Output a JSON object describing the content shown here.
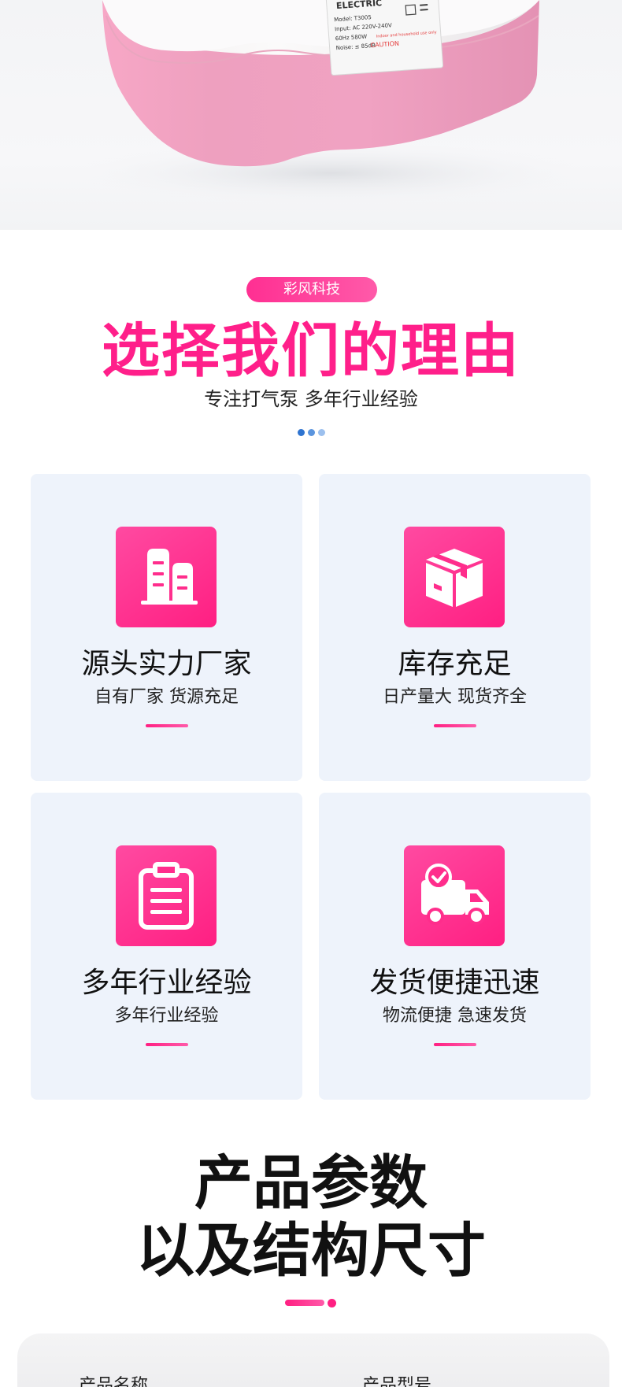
{
  "hero": {
    "device_label": {
      "brand": "ELECTRIC",
      "model": "Model: T3005",
      "input": "Input: AC 220V-240V",
      "freq": "60Hz 580W",
      "noise": "Noise: ≤ 85dB",
      "caution": "CAUTION",
      "indoor_note": "Indoor and household use only"
    }
  },
  "section_reasons": {
    "badge": "彩风科技",
    "title": "选择我们的理由",
    "subtitle": "专注打气泵 多年行业经验"
  },
  "cards": [
    {
      "title": "源头实力厂家",
      "subtitle": "自有厂家 货源充足",
      "icon": "building-icon"
    },
    {
      "title": "库存充足",
      "subtitle": "日产量大 现货齐全",
      "icon": "box-icon"
    },
    {
      "title": "多年行业经验",
      "subtitle": "多年行业经验",
      "icon": "clipboard-icon"
    },
    {
      "title": "发货便捷迅速",
      "subtitle": "物流便捷 急速发货",
      "icon": "truck-icon"
    }
  ],
  "section_params": {
    "title_line1": "产品参数",
    "title_line2": "以及结构尺寸",
    "label_name": "产品名称",
    "label_model": "产品型号"
  },
  "colors": {
    "accent": "#ff1f8a",
    "card_bg": "#eef3fb",
    "dot_1": "#2f74d0",
    "dot_2": "#5b95de",
    "dot_3": "#9cc0ee"
  }
}
